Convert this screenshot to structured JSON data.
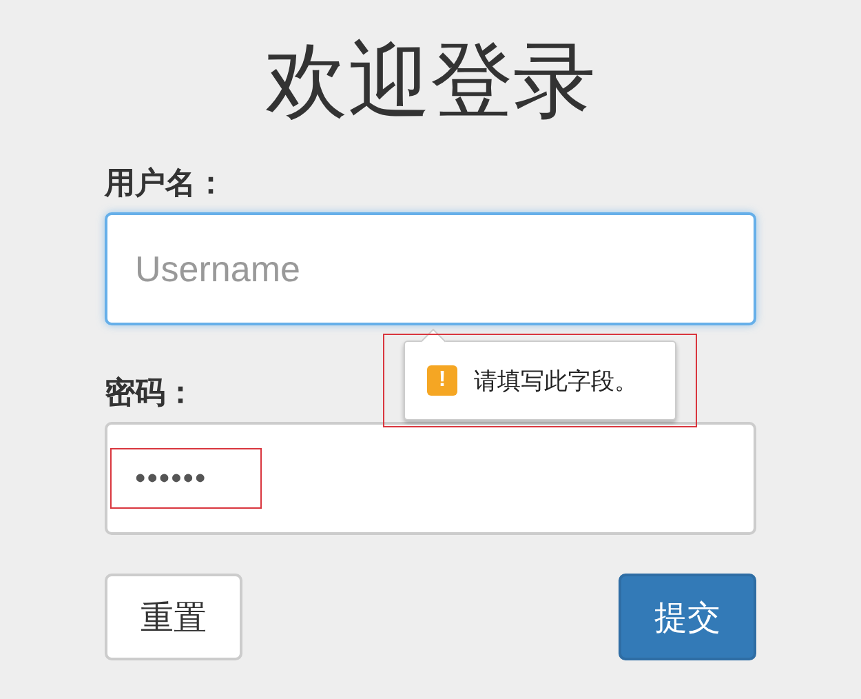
{
  "title": "欢迎登录",
  "username": {
    "label": "用户名：",
    "placeholder": "Username",
    "focused": true
  },
  "tooltip": {
    "text": "请填写此字段。",
    "icon": "!",
    "highlighted": true
  },
  "password": {
    "label": "密码：",
    "value": "••••••",
    "highlighted": true
  },
  "buttons": [
    {
      "label": "重置",
      "kind": "default"
    },
    {
      "label": "提交",
      "kind": "primary"
    }
  ]
}
